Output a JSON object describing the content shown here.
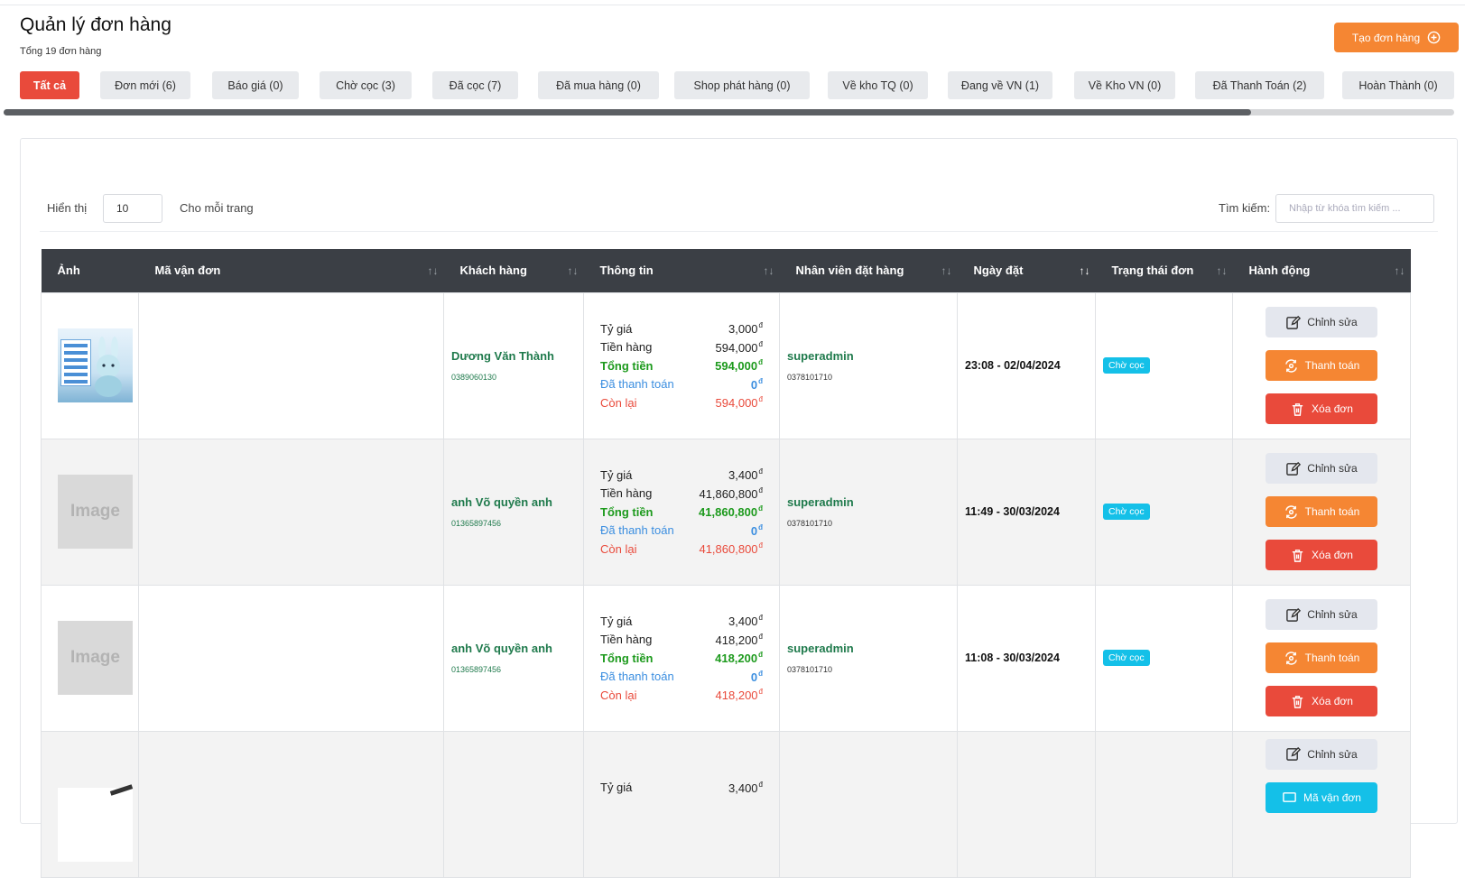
{
  "header": {
    "title": "Quản lý đơn hàng",
    "subtitle": "Tổng 19 đơn hàng",
    "create_button": "Tạo đơn hàng"
  },
  "tabs": [
    {
      "label": "Tất cả",
      "active": true
    },
    {
      "label": "Đơn mới (6)",
      "active": false
    },
    {
      "label": "Báo giá (0)",
      "active": false
    },
    {
      "label": "Chờ cọc (3)",
      "active": false
    },
    {
      "label": "Đã cọc (7)",
      "active": false
    },
    {
      "label": "Đã mua hàng (0)",
      "active": false
    },
    {
      "label": "Shop phát hàng (0)",
      "active": false
    },
    {
      "label": "Về kho TQ (0)",
      "active": false
    },
    {
      "label": "Đang về VN (1)",
      "active": false
    },
    {
      "label": "Về Kho VN (0)",
      "active": false
    },
    {
      "label": "Đã Thanh Toán (2)",
      "active": false
    },
    {
      "label": "Hoàn Thành (0)",
      "active": false
    }
  ],
  "controls": {
    "show_label": "Hiển thị",
    "page_size": "10",
    "per_page_label": "Cho mỗi trang",
    "search_label": "Tìm kiếm:",
    "search_placeholder": "Nhập từ khóa tìm kiếm ..."
  },
  "table": {
    "columns": [
      "Ảnh",
      "Mã vận đơn",
      "Khách hàng",
      "Thông tin",
      "Nhân viên đặt hàng",
      "Ngày đặt",
      "Trạng thái đơn",
      "Hành động"
    ],
    "info_labels": {
      "rate": "Tỷ giá",
      "goods": "Tiền hàng",
      "total": "Tổng tiền",
      "paid": "Đã thanh toán",
      "remain": "Còn lại"
    },
    "currency": "đ",
    "placeholder_image_text": "Image",
    "actions": {
      "edit": "Chỉnh sửa",
      "pay": "Thanh toán",
      "delete": "Xóa đơn",
      "tracking": "Mã vận đơn"
    },
    "rows": [
      {
        "image": "product",
        "tracking": "",
        "customer_name": "Dương Văn Thành",
        "customer_phone": "0389060130",
        "rate": "3,000",
        "goods": "594,000",
        "total": "594,000",
        "paid": "0",
        "remain": "594,000",
        "staff_name": "superadmin",
        "staff_phone": "0378101710",
        "date": "23:08 - 02/04/2024",
        "status": "Chờ cọc"
      },
      {
        "image": "placeholder",
        "tracking": "",
        "customer_name": "anh Võ quyền anh",
        "customer_phone": "01365897456",
        "rate": "3,400",
        "goods": "41,860,800",
        "total": "41,860,800",
        "paid": "0",
        "remain": "41,860,800",
        "staff_name": "superadmin",
        "staff_phone": "0378101710",
        "date": "11:49 - 30/03/2024",
        "status": "Chờ cọc"
      },
      {
        "image": "placeholder",
        "tracking": "",
        "customer_name": "anh Võ quyền anh",
        "customer_phone": "01365897456",
        "rate": "3,400",
        "goods": "418,200",
        "total": "418,200",
        "paid": "0",
        "remain": "418,200",
        "staff_name": "superadmin",
        "staff_phone": "0378101710",
        "date": "11:08 - 30/03/2024",
        "status": "Chờ cọc"
      },
      {
        "image": "partial",
        "rate": "3,400"
      }
    ]
  }
}
